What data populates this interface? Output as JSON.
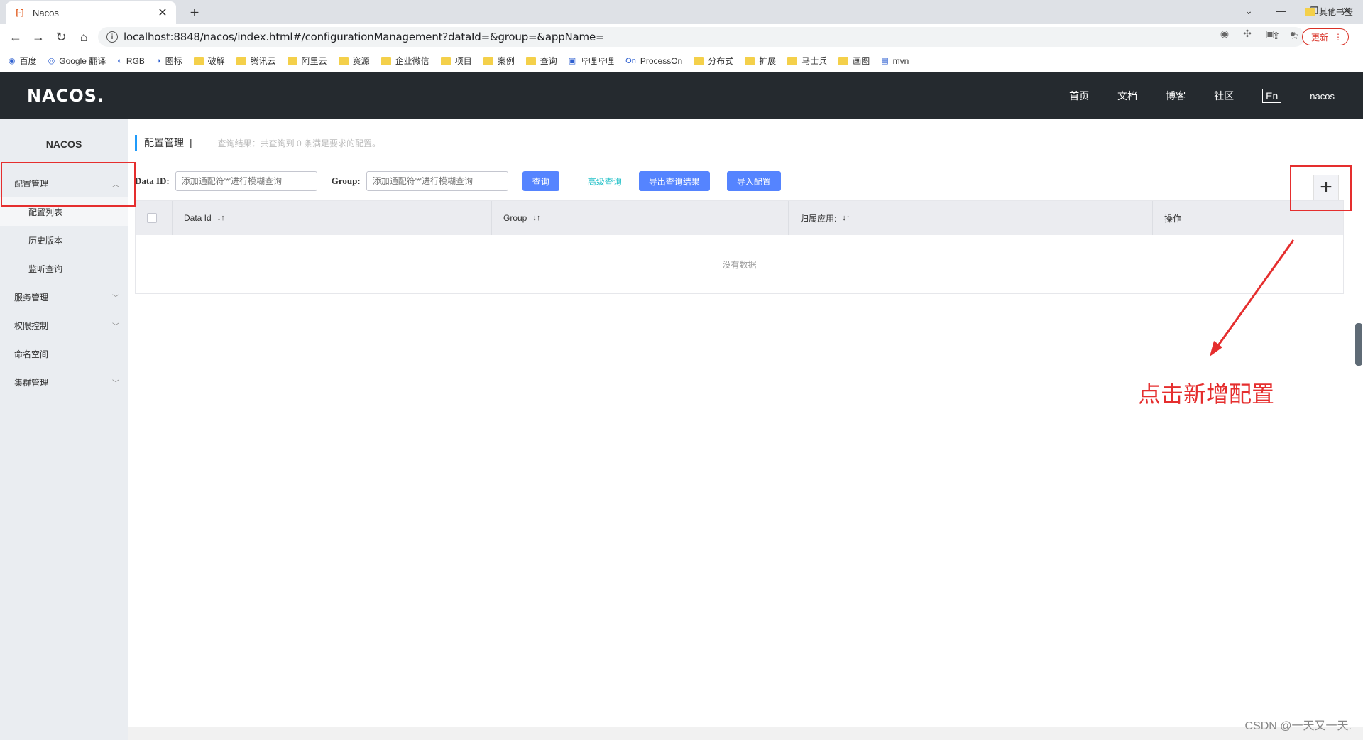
{
  "browser": {
    "tab_title": "Nacos",
    "url": "localhost:8848/nacos/index.html#/configurationManagement?dataId=&group=&appName=",
    "update_label": "更新",
    "bookmarks": [
      "百度",
      "Google 翻译",
      "RGB",
      "图标",
      "破解",
      "腾讯云",
      "阿里云",
      "资源",
      "企业微信",
      "项目",
      "案例",
      "查询",
      "哔哩哔哩",
      "ProcessOn",
      "分布式",
      "扩展",
      "马士兵",
      "画图",
      "mvn"
    ],
    "other_bookmarks": "其他书签"
  },
  "header": {
    "logo": "NACOS.",
    "nav": [
      "首页",
      "文档",
      "博客",
      "社区"
    ],
    "lang": "En",
    "user": "nacos"
  },
  "sidebar": {
    "title": "NACOS",
    "items": [
      {
        "label": "配置管理",
        "arrow": "︿"
      },
      {
        "label": "配置列表"
      },
      {
        "label": "历史版本"
      },
      {
        "label": "监听查询"
      },
      {
        "label": "服务管理",
        "arrow": "﹀"
      },
      {
        "label": "权限控制",
        "arrow": "﹀"
      },
      {
        "label": "命名空间"
      },
      {
        "label": "集群管理",
        "arrow": "﹀"
      }
    ]
  },
  "main": {
    "title": "配置管理",
    "separator": "|",
    "result_desc": "查询结果：共查询到 0 条满足要求的配置。",
    "dataid_label": "Data ID:",
    "dataid_placeholder": "添加通配符'*'进行模糊查询",
    "group_label": "Group:",
    "group_placeholder": "添加通配符'*'进行模糊查询",
    "query_btn": "查询",
    "advanced_link": "高级查询",
    "export_btn": "导出查询结果",
    "import_btn": "导入配置",
    "plus": "+",
    "columns": [
      "Data Id",
      "Group",
      "归属应用:",
      "操作"
    ],
    "sort_icon": "↓↑",
    "empty": "没有数据"
  },
  "annotation": {
    "note": "点击新增配置",
    "color": "#e52e2e"
  },
  "watermark": "CSDN @一天又一天."
}
